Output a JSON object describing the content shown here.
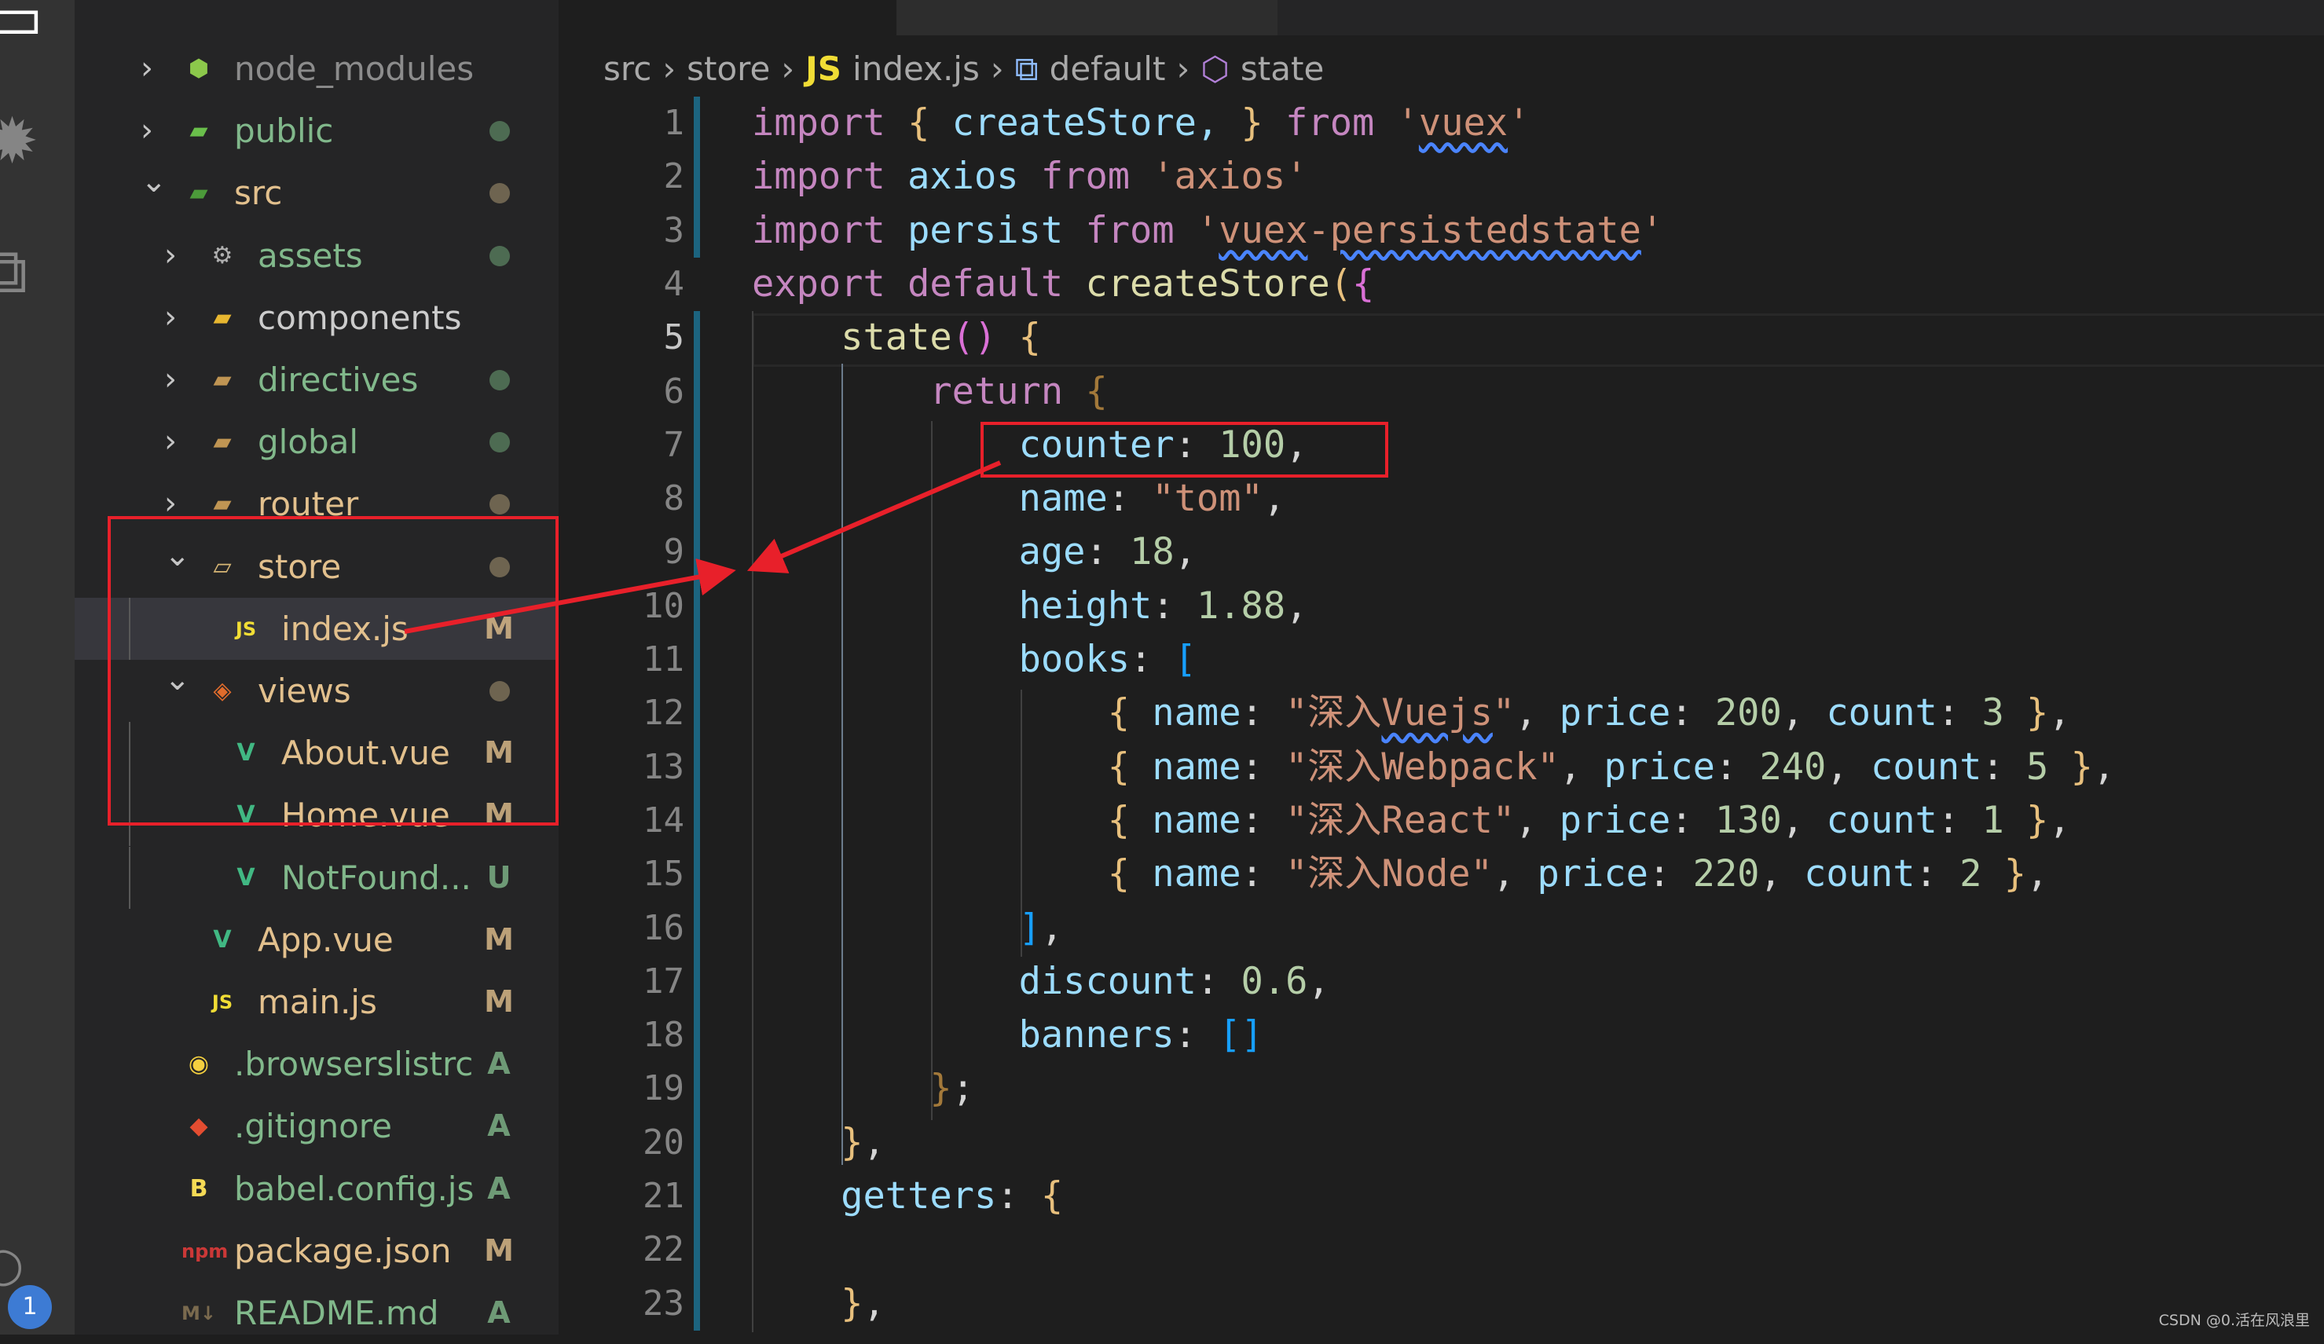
{
  "activity_bar": {
    "icons": [
      "remote-explorer-icon",
      "badge-extension-icon",
      "extensions-icon",
      "accounts-icon"
    ],
    "badge_count": "1"
  },
  "explorer": {
    "status_colors": {
      "modified": "#e2c08d",
      "added": "#81b88b",
      "ignored": "#8c8c8c"
    },
    "items": [
      {
        "label": "node_modules",
        "depth": 0,
        "chevron": "right",
        "icon": "nodejs-folder-icon",
        "color": "gray",
        "status": ""
      },
      {
        "label": "public",
        "depth": 0,
        "chevron": "right",
        "icon": "public-folder-icon",
        "color": "green",
        "status": "dot-green"
      },
      {
        "label": "src",
        "depth": 0,
        "chevron": "down",
        "icon": "src-folder-icon",
        "color": "tan",
        "status": "dot-tan"
      },
      {
        "label": "assets",
        "depth": 1,
        "chevron": "right",
        "icon": "assets-folder-icon",
        "color": "green",
        "status": "dot-green"
      },
      {
        "label": "components",
        "depth": 1,
        "chevron": "right",
        "icon": "components-folder-icon",
        "color": "white",
        "status": ""
      },
      {
        "label": "directives",
        "depth": 1,
        "chevron": "right",
        "icon": "folder-icon",
        "color": "green",
        "status": "dot-green"
      },
      {
        "label": "global",
        "depth": 1,
        "chevron": "right",
        "icon": "folder-icon",
        "color": "green",
        "status": "dot-green"
      },
      {
        "label": "router",
        "depth": 1,
        "chevron": "right",
        "icon": "folder-icon",
        "color": "tan",
        "status": "dot-tan"
      },
      {
        "label": "store",
        "depth": 1,
        "chevron": "down",
        "icon": "folder-open-icon",
        "color": "tan",
        "status": "dot-tan"
      },
      {
        "label": "index.js",
        "depth": 2,
        "chevron": "",
        "icon": "js-file-icon",
        "color": "tan",
        "status": "M",
        "selected": true
      },
      {
        "label": "views",
        "depth": 1,
        "chevron": "down",
        "icon": "views-folder-icon",
        "color": "tan",
        "status": "dot-tan"
      },
      {
        "label": "About.vue",
        "depth": 2,
        "chevron": "",
        "icon": "vue-file-icon",
        "color": "tan",
        "status": "M"
      },
      {
        "label": "Home.vue",
        "depth": 2,
        "chevron": "",
        "icon": "vue-file-icon",
        "color": "tan",
        "status": "M"
      },
      {
        "label": "NotFound...",
        "depth": 2,
        "chevron": "",
        "icon": "vue-file-icon",
        "color": "green",
        "status": "U"
      },
      {
        "label": "App.vue",
        "depth": 1,
        "chevron": "",
        "icon": "vue-file-icon",
        "color": "tan",
        "status": "M"
      },
      {
        "label": "main.js",
        "depth": 1,
        "chevron": "",
        "icon": "js-file-icon",
        "color": "tan",
        "status": "M"
      },
      {
        "label": ".browserslistrc",
        "depth": 0,
        "chevron": "",
        "icon": "browserslist-file-icon",
        "color": "green",
        "status": "A"
      },
      {
        "label": ".gitignore",
        "depth": 0,
        "chevron": "",
        "icon": "git-file-icon",
        "color": "green",
        "status": "A"
      },
      {
        "label": "babel.config.js",
        "depth": 0,
        "chevron": "",
        "icon": "babel-file-icon",
        "color": "green",
        "status": "A"
      },
      {
        "label": "package.json",
        "depth": 0,
        "chevron": "",
        "icon": "npm-file-icon",
        "color": "tan",
        "status": "M"
      },
      {
        "label": "README.md",
        "depth": 0,
        "chevron": "",
        "icon": "markdown-file-icon",
        "color": "green",
        "status": "A"
      }
    ]
  },
  "breadcrumb": {
    "items": [
      "src",
      "store",
      "index.js",
      "default",
      "state"
    ],
    "js_badge": "JS"
  },
  "editor": {
    "active_line": 5,
    "modified_lines": [
      [
        1,
        3
      ],
      [
        5,
        23
      ]
    ],
    "lines": [
      [
        [
          "import",
          "k"
        ],
        [
          " ",
          "p"
        ],
        [
          "{",
          "b1"
        ],
        [
          " createStore, ",
          "v"
        ],
        [
          "}",
          "b1"
        ],
        [
          " ",
          "p"
        ],
        [
          "from",
          "k"
        ],
        [
          " '",
          "s"
        ],
        [
          "vuex",
          "s sq"
        ],
        [
          "'",
          "s"
        ]
      ],
      [
        [
          "import",
          "k"
        ],
        [
          " axios ",
          "v"
        ],
        [
          "from",
          "k"
        ],
        [
          " 'axios'",
          "s"
        ]
      ],
      [
        [
          "import",
          "k"
        ],
        [
          " persist ",
          "v"
        ],
        [
          "from",
          "k"
        ],
        [
          " '",
          "s"
        ],
        [
          "vuex",
          "s sq"
        ],
        [
          "-",
          "s"
        ],
        [
          "persistedstate",
          "s sq"
        ],
        [
          "'",
          "s"
        ]
      ],
      [
        [
          "export",
          "k"
        ],
        [
          " default ",
          "k"
        ],
        [
          "createStore",
          "f"
        ],
        [
          "(",
          "b1"
        ],
        [
          "{",
          "b2"
        ]
      ],
      [
        [
          "    ",
          "p"
        ],
        [
          "state",
          "f"
        ],
        [
          "()",
          "b2"
        ],
        [
          " ",
          "p"
        ],
        [
          "{",
          "b1"
        ]
      ],
      [
        [
          "        ",
          "p"
        ],
        [
          "return",
          "k"
        ],
        [
          " ",
          "p"
        ],
        [
          "{",
          "b4"
        ]
      ],
      [
        [
          "            ",
          "p"
        ],
        [
          "counter",
          "v"
        ],
        [
          ": ",
          "p"
        ],
        [
          "100",
          "n"
        ],
        [
          ",",
          "p"
        ]
      ],
      [
        [
          "            ",
          "p"
        ],
        [
          "name",
          "v"
        ],
        [
          ": ",
          "p"
        ],
        [
          "\"tom\"",
          "s"
        ],
        [
          ",",
          "p"
        ]
      ],
      [
        [
          "            ",
          "p"
        ],
        [
          "age",
          "v"
        ],
        [
          ": ",
          "p"
        ],
        [
          "18",
          "n"
        ],
        [
          ",",
          "p"
        ]
      ],
      [
        [
          "            ",
          "p"
        ],
        [
          "height",
          "v"
        ],
        [
          ": ",
          "p"
        ],
        [
          "1.88",
          "n"
        ],
        [
          ",",
          "p"
        ]
      ],
      [
        [
          "            ",
          "p"
        ],
        [
          "books",
          "v"
        ],
        [
          ": ",
          "p"
        ],
        [
          "[",
          "b3"
        ]
      ],
      [
        [
          "                ",
          "p"
        ],
        [
          "{",
          "b1"
        ],
        [
          " name",
          "v"
        ],
        [
          ": ",
          "p"
        ],
        [
          "\"深入",
          "s"
        ],
        [
          "Vuejs",
          "s sq"
        ],
        [
          "\"",
          "s"
        ],
        [
          ", ",
          "p"
        ],
        [
          "price",
          "v"
        ],
        [
          ": ",
          "p"
        ],
        [
          "200",
          "n"
        ],
        [
          ", ",
          "p"
        ],
        [
          "count",
          "v"
        ],
        [
          ": ",
          "p"
        ],
        [
          "3",
          "n"
        ],
        [
          " ",
          "p"
        ],
        [
          "}",
          "b1"
        ],
        [
          ",",
          "p"
        ]
      ],
      [
        [
          "                ",
          "p"
        ],
        [
          "{",
          "b1"
        ],
        [
          " name",
          "v"
        ],
        [
          ": ",
          "p"
        ],
        [
          "\"深入Webpack\"",
          "s"
        ],
        [
          ", ",
          "p"
        ],
        [
          "price",
          "v"
        ],
        [
          ": ",
          "p"
        ],
        [
          "240",
          "n"
        ],
        [
          ", ",
          "p"
        ],
        [
          "count",
          "v"
        ],
        [
          ": ",
          "p"
        ],
        [
          "5",
          "n"
        ],
        [
          " ",
          "p"
        ],
        [
          "}",
          "b1"
        ],
        [
          ",",
          "p"
        ]
      ],
      [
        [
          "                ",
          "p"
        ],
        [
          "{",
          "b1"
        ],
        [
          " name",
          "v"
        ],
        [
          ": ",
          "p"
        ],
        [
          "\"深入React\"",
          "s"
        ],
        [
          ", ",
          "p"
        ],
        [
          "price",
          "v"
        ],
        [
          ": ",
          "p"
        ],
        [
          "130",
          "n"
        ],
        [
          ", ",
          "p"
        ],
        [
          "count",
          "v"
        ],
        [
          ": ",
          "p"
        ],
        [
          "1",
          "n"
        ],
        [
          " ",
          "p"
        ],
        [
          "}",
          "b1"
        ],
        [
          ",",
          "p"
        ]
      ],
      [
        [
          "                ",
          "p"
        ],
        [
          "{",
          "b1"
        ],
        [
          " name",
          "v"
        ],
        [
          ": ",
          "p"
        ],
        [
          "\"深入Node\"",
          "s"
        ],
        [
          ", ",
          "p"
        ],
        [
          "price",
          "v"
        ],
        [
          ": ",
          "p"
        ],
        [
          "220",
          "n"
        ],
        [
          ", ",
          "p"
        ],
        [
          "count",
          "v"
        ],
        [
          ": ",
          "p"
        ],
        [
          "2",
          "n"
        ],
        [
          " ",
          "p"
        ],
        [
          "}",
          "b1"
        ],
        [
          ",",
          "p"
        ]
      ],
      [
        [
          "            ",
          "p"
        ],
        [
          "]",
          "b3"
        ],
        [
          ",",
          "p"
        ]
      ],
      [
        [
          "            ",
          "p"
        ],
        [
          "discount",
          "v"
        ],
        [
          ": ",
          "p"
        ],
        [
          "0.6",
          "n"
        ],
        [
          ",",
          "p"
        ]
      ],
      [
        [
          "            ",
          "p"
        ],
        [
          "banners",
          "v"
        ],
        [
          ": ",
          "p"
        ],
        [
          "[]",
          "b3"
        ]
      ],
      [
        [
          "        ",
          "p"
        ],
        [
          "}",
          "b4"
        ],
        [
          ";",
          "p"
        ]
      ],
      [
        [
          "    ",
          "p"
        ],
        [
          "}",
          "b1"
        ],
        [
          ",",
          "p"
        ]
      ],
      [
        [
          "    ",
          "p"
        ],
        [
          "getters",
          "v"
        ],
        [
          ": ",
          "p"
        ],
        [
          "{",
          "b1"
        ]
      ],
      [
        [
          "",
          "p"
        ]
      ],
      [
        [
          "    ",
          "p"
        ],
        [
          "}",
          "b1"
        ],
        [
          ",",
          "p"
        ]
      ]
    ]
  },
  "annotation_color": "#e8202a",
  "watermark": "CSDN @0.活在风浪里"
}
